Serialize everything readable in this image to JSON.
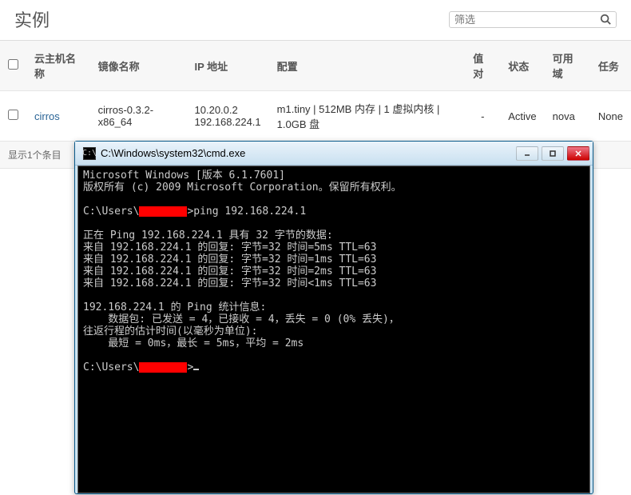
{
  "header": {
    "title": "实例",
    "filter_placeholder": "筛选"
  },
  "table": {
    "columns": {
      "host": "云主机名称",
      "image": "镜像名称",
      "ip": "IP 地址",
      "config": "配置",
      "pair": "值对",
      "status": "状态",
      "zone": "可用域",
      "task": "任务"
    },
    "rows": [
      {
        "host": "cirros",
        "image": "cirros-0.3.2-x86_64",
        "ip_line1": "10.20.0.2",
        "ip_line2": "192.168.224.1",
        "config": "m1.tiny | 512MB 内存 | 1 虚拟内核 | 1.0GB 盘",
        "pair": "-",
        "status": "Active",
        "zone": "nova",
        "task": "None"
      }
    ],
    "footer": "显示1个条目"
  },
  "cmd": {
    "title_path": "C:\\Windows\\system32\\cmd.exe",
    "icon_glyph": "C:\\",
    "line1": "Microsoft Windows [版本 6.1.7601]",
    "line2": "版权所有 (c) 2009 Microsoft Corporation。保留所有权利。",
    "prompt1_a": "C:\\Users\\",
    "prompt1_b": ">ping 192.168.224.1",
    "ping_header": "正在 Ping 192.168.224.1 具有 32 字节的数据:",
    "reply1": "来自 192.168.224.1 的回复: 字节=32 时间=5ms TTL=63",
    "reply2": "来自 192.168.224.1 的回复: 字节=32 时间=1ms TTL=63",
    "reply3": "来自 192.168.224.1 的回复: 字节=32 时间=2ms TTL=63",
    "reply4": "来自 192.168.224.1 的回复: 字节=32 时间<1ms TTL=63",
    "stats_header": "192.168.224.1 的 Ping 统计信息:",
    "stats_packets": "    数据包: 已发送 = 4，已接收 = 4，丢失 = 0 (0% 丢失)，",
    "rtt_header": "往返行程的估计时间(以毫秒为单位):",
    "rtt_values": "    最短 = 0ms，最长 = 5ms，平均 = 2ms",
    "prompt2_a": "C:\\Users\\",
    "prompt2_b": ">"
  }
}
